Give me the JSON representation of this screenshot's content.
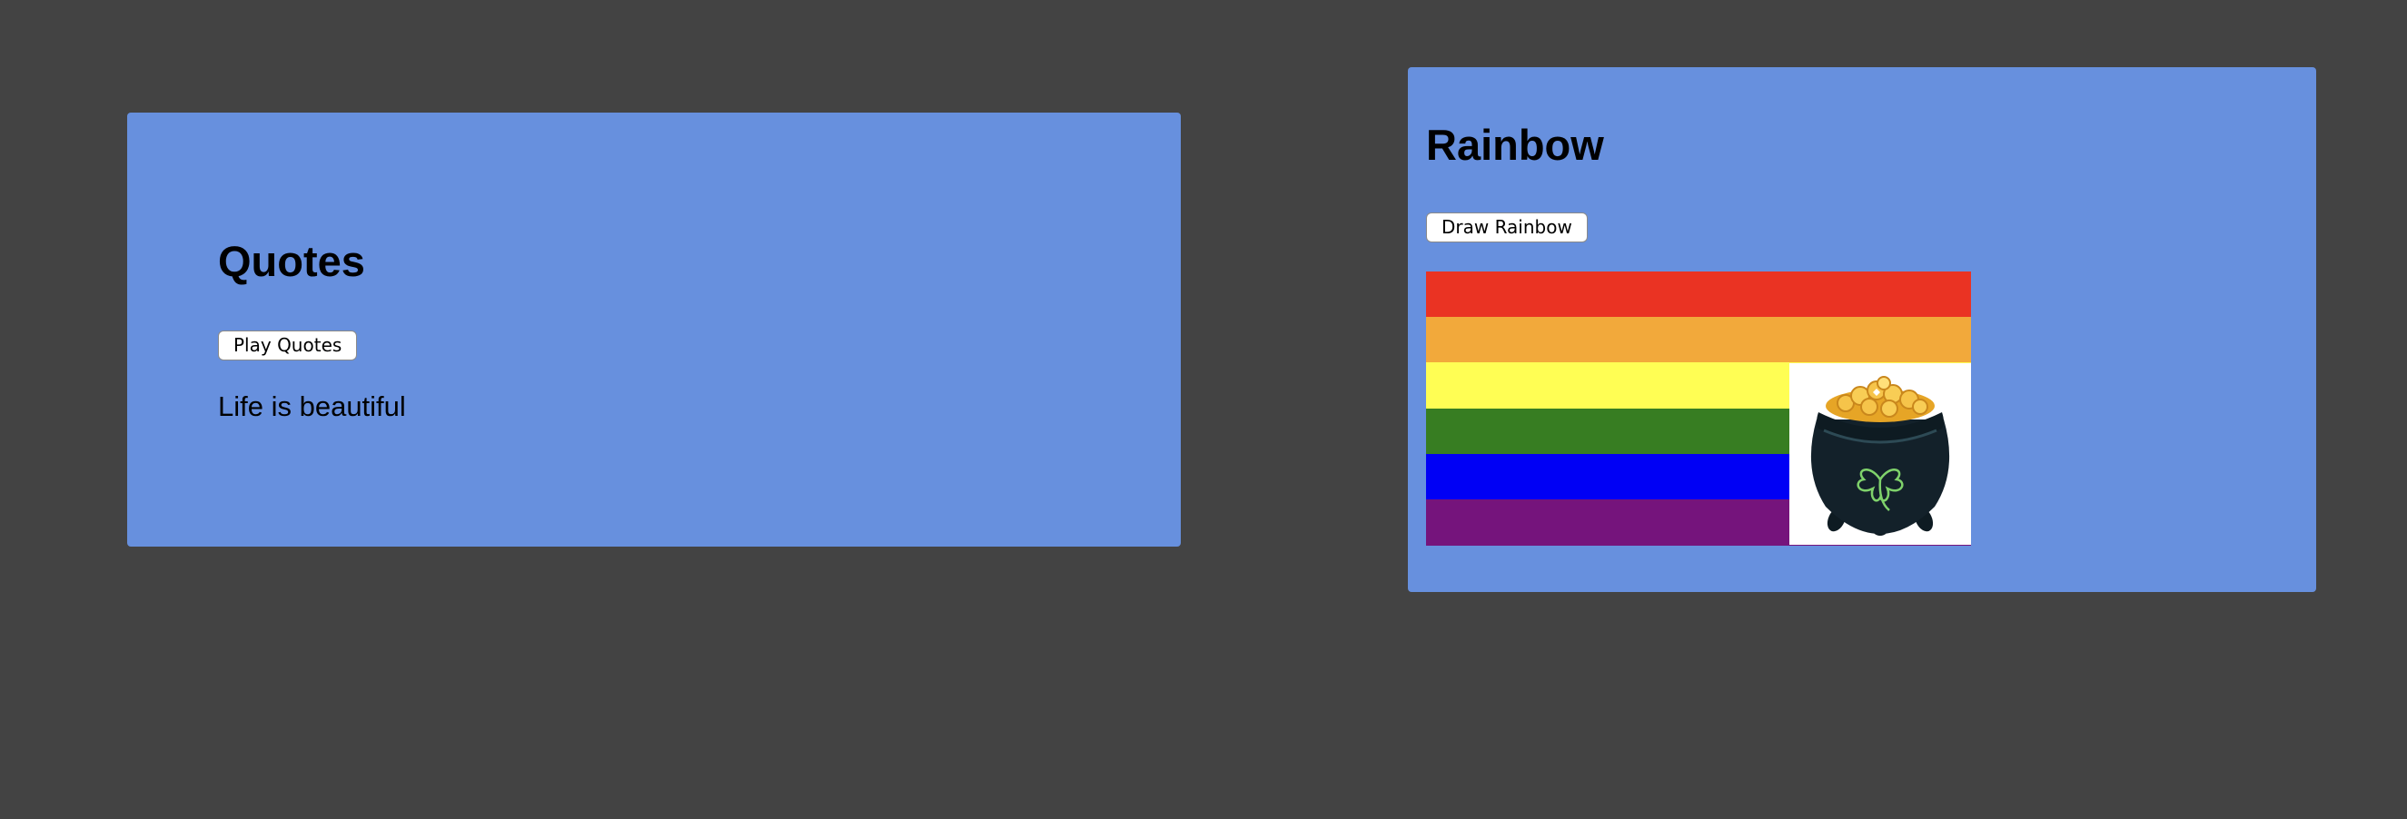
{
  "quotes": {
    "title": "Quotes",
    "button_label": "Play Quotes",
    "quote": "Life is beautiful"
  },
  "rainbow": {
    "title": "Rainbow",
    "button_label": "Draw Rainbow",
    "stripes": [
      {
        "name": "red",
        "color": "#ea3323"
      },
      {
        "name": "orange",
        "color": "#f2a93b"
      },
      {
        "name": "yellow",
        "color": "#fffe54"
      },
      {
        "name": "green",
        "color": "#377d22"
      },
      {
        "name": "blue",
        "color": "#0000f5"
      },
      {
        "name": "purple",
        "color": "#75147c"
      }
    ],
    "image_icon": "pot-of-gold-icon"
  },
  "colors": {
    "page_background": "#434343",
    "card_background": "#6790de"
  }
}
